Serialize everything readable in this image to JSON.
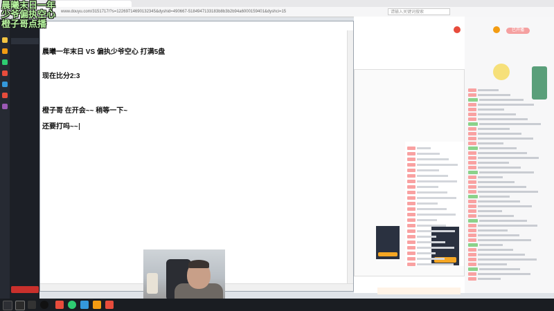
{
  "overlay": {
    "line1": "晨曦末日一年",
    "line2": "少爷偏执空心",
    "line3": "橙子哥点播"
  },
  "browser": {
    "url": "www.douyu.com/3151717/?s=12269714690132345&dyshid=490667-5184947133183b8b3b2b94a6000159401&dyshci=15",
    "search_placeholder": "请输入关键词搜索"
  },
  "notepad": {
    "lines": [
      "晨曦一年末日  VS  偏执少爷空心      打满5盘",
      "现在比分2:3",
      "橙子哥 在开会~~ 稍等一下~",
      "还要打吗~~"
    ]
  },
  "web": {
    "live_button": "已开播"
  },
  "colors": {
    "overlay_text": "#b8f5a0",
    "sidebar_bg": "#1c1f26",
    "accent_red": "#e74c3c"
  }
}
